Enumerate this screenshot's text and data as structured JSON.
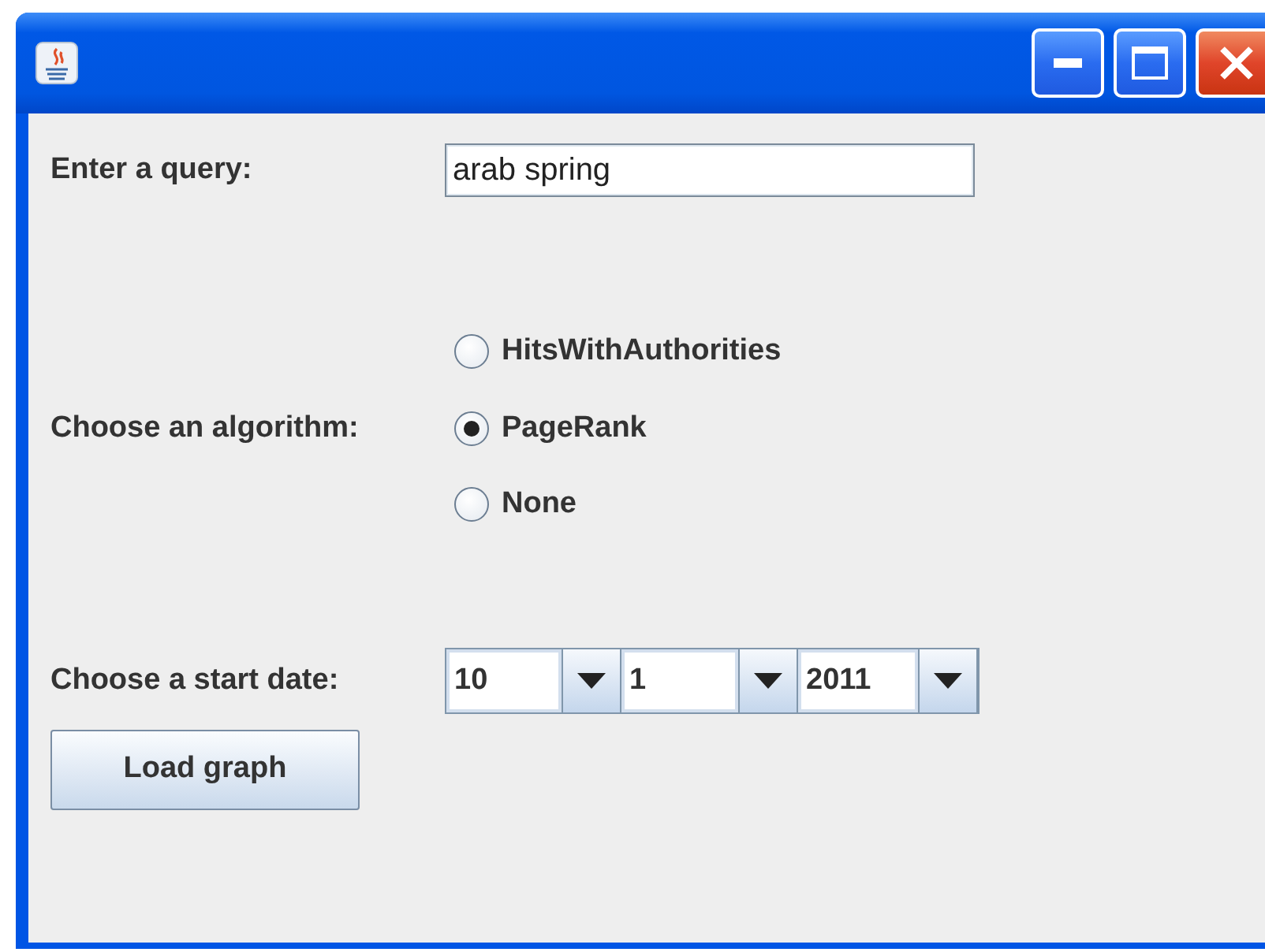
{
  "query": {
    "label": "Enter a query:",
    "value": "arab spring"
  },
  "algorithm": {
    "label": "Choose an algorithm:",
    "options": [
      {
        "label": "HitsWithAuthorities",
        "selected": false
      },
      {
        "label": "PageRank",
        "selected": true
      },
      {
        "label": "None",
        "selected": false
      }
    ]
  },
  "start_date": {
    "label": "Choose a start date:",
    "combos": [
      {
        "value": "10"
      },
      {
        "value": "1"
      },
      {
        "value": "2011"
      }
    ]
  },
  "buttons": [
    {
      "label": "Load graph"
    }
  ]
}
